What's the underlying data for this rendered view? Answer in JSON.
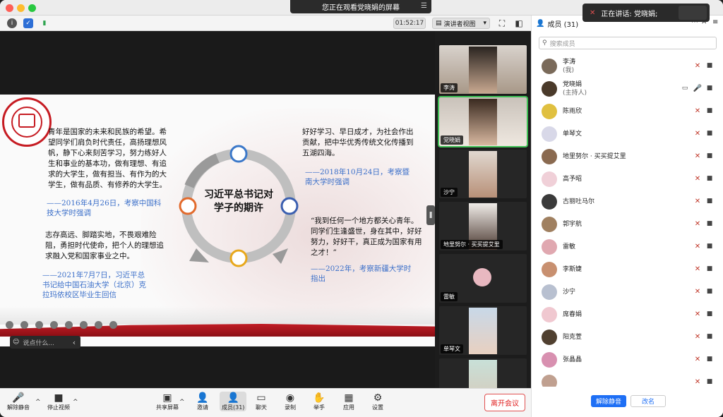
{
  "share_banner": "您正在观看党晓娟的屏幕",
  "speaking": "正在讲话: 党晓娟;",
  "timer": "01:52:17",
  "view_mode": "演讲者视图",
  "slide": {
    "para1": "青年是国家的未来和民族的希望。希望同学们肩负时代责任，高扬理想风帆，静下心来刻苦学习，努力练好人生和事业的基本功，做有理想、有追求的大学生，做有担当、有作为的大学生，做有品质、有修养的大学生。",
    "cite1": "——2016年4月26日，考察中国科技大学时强调",
    "para2": "志存高远、脚踏实地，不畏艰难险阻，勇担时代使命，把个人的理想追求融入党和国家事业之中。",
    "cite2": "——2021年7月7日，习近平总书记给中国石油大学（北京）克拉玛依校区毕业生回信",
    "para3": "好好学习、早日成才，为社会作出贡献，把中华优秀传统文化传播到五湖四海。",
    "cite3": "——2018年10月24日，考察暨南大学时强调",
    "para4": "“我到任何一个地方都关心青年。同学们生逢盛世，身在其中，好好努力，好好干，真正成为国家有用之才！”",
    "cite4": "——2022年，考察新疆大学时指出",
    "center": "习近平总书记对学子的期许"
  },
  "chat_placeholder": "说点什么...",
  "gallery": [
    {
      "name": "李涛"
    },
    {
      "name": "党晓娟"
    },
    {
      "name": "沙宁"
    },
    {
      "name": "地里努尔 · 买买提艾里"
    },
    {
      "name": "雷敏"
    },
    {
      "name": "单琴文"
    },
    {
      "name": ""
    }
  ],
  "bottom": {
    "unmute": "解除静音",
    "stop_video": "停止视频",
    "share": "共享屏幕",
    "invite": "邀请",
    "members": "成员(31)",
    "chat": "聊天",
    "record": "录制",
    "raise": "举手",
    "apps": "应用",
    "settings": "设置",
    "leave": "离开会议"
  },
  "panel": {
    "title": "成员 (31)",
    "search_placeholder": "搜索成员",
    "unmute_all": "解除静音",
    "rename": "改名",
    "members": [
      {
        "name": "李涛",
        "sub": "(我)",
        "color": "#7a6a5a"
      },
      {
        "name": "党晓娟",
        "sub": "(主持人)",
        "color": "#4a3a2a"
      },
      {
        "name": "陈雨欣",
        "sub": "",
        "color": "#e0c040"
      },
      {
        "name": "单琴文",
        "sub": "",
        "color": "#d8d8e8"
      },
      {
        "name": "地里努尔 · 买买提艾里",
        "sub": "",
        "color": "#8a6a50"
      },
      {
        "name": "高予昭",
        "sub": "",
        "color": "#f0d0d8"
      },
      {
        "name": "古丽吐马尔",
        "sub": "",
        "color": "#3a3a3a"
      },
      {
        "name": "郭宇航",
        "sub": "",
        "color": "#a08060"
      },
      {
        "name": "雷敏",
        "sub": "",
        "color": "#e0a8b0"
      },
      {
        "name": "李斯婕",
        "sub": "",
        "color": "#c89070"
      },
      {
        "name": "沙宁",
        "sub": "",
        "color": "#b8c0d0"
      },
      {
        "name": "席春娟",
        "sub": "",
        "color": "#f0c8d0"
      },
      {
        "name": "阳克萱",
        "sub": "",
        "color": "#504030"
      },
      {
        "name": "张晶晶",
        "sub": "",
        "color": "#d890b0"
      },
      {
        "name": "",
        "sub": "",
        "color": "#c0a090"
      }
    ]
  }
}
